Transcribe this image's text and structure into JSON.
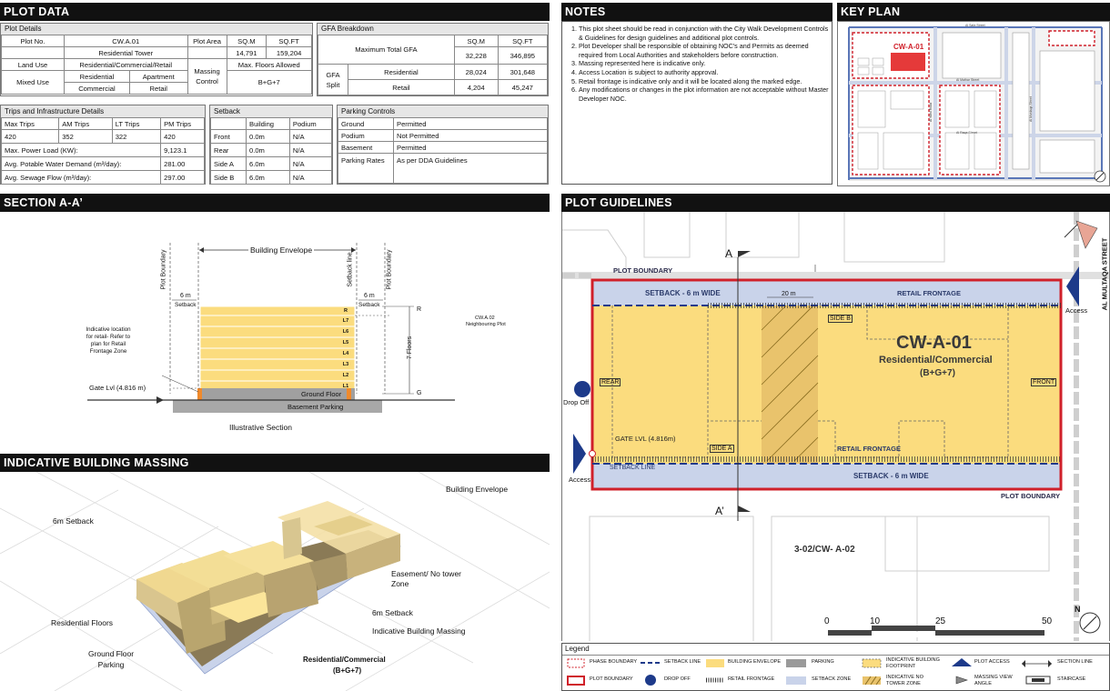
{
  "plot_data": {
    "header": "PLOT DATA",
    "plot_details": {
      "title": "Plot Details",
      "plot_no_label": "Plot No.",
      "plot_no": "CW.A.01",
      "residential_tower": "Residential Tower",
      "plot_area_label": "Plot Area",
      "sqm_label": "SQ.M",
      "sqft_label": "SQ.FT",
      "plot_area_sqm": "14,791",
      "plot_area_sqft": "159,204",
      "land_use_label": "Land Use",
      "land_use": "Residential/Commercial/Retail",
      "max_floors_label": "Max. Floors Allowed",
      "mixed_use_label": "Mixed Use",
      "residential": "Residential",
      "apartment": "Apartment",
      "commercial": "Commercial",
      "retail": "Retail",
      "massing_control_label": "Massing Control",
      "max_floors": "B+G+7"
    },
    "gfa": {
      "title": "GFA Breakdown",
      "max_total_label": "Maximum Total GFA",
      "sqm_label": "SQ.M",
      "sqft_label": "SQ.FT",
      "total_sqm": "32,228",
      "total_sqft": "346,895",
      "split_label": "GFA Split",
      "residential_label": "Residential",
      "residential_sqm": "28,024",
      "residential_sqft": "301,648",
      "retail_label": "Retail",
      "retail_sqm": "4,204",
      "retail_sqft": "45,247"
    },
    "trips": {
      "title": "Trips and Infrastructure Details",
      "headers": [
        "Max Trips",
        "AM Trips",
        "LT Trips",
        "PM Trips"
      ],
      "values": [
        "420",
        "352",
        "322",
        "420"
      ],
      "power_label": "Max. Power Load (KW):",
      "power": "9,123.1",
      "water_label": "Avg. Potable Water Demand (m³/day):",
      "water": "281.00",
      "sewage_label": "Avg. Sewage Flow (m³/day):",
      "sewage": "297.00"
    },
    "setback": {
      "title": "Setback",
      "col_building": "Building",
      "col_podium": "Podium",
      "rows": [
        {
          "side": "Front",
          "building": "0.0m",
          "podium": "N/A"
        },
        {
          "side": "Rear",
          "building": "0.0m",
          "podium": "N/A"
        },
        {
          "side": "Side A",
          "building": "6.0m",
          "podium": "N/A"
        },
        {
          "side": "Side B",
          "building": "6.0m",
          "podium": "N/A"
        }
      ]
    },
    "parking": {
      "title": "Parking Controls",
      "rows": [
        {
          "label": "Ground",
          "value": "Permitted"
        },
        {
          "label": "Podium",
          "value": "Not Permitted"
        },
        {
          "label": "Basement",
          "value": "Permitted"
        },
        {
          "label": "Parking Rates",
          "value": "As per DDA Guidelines"
        }
      ]
    }
  },
  "notes": {
    "header": "NOTES",
    "items": [
      "This plot sheet should be read in conjunction with the City Walk Development Controls & Guidelines for design guidelines and additional plot controls.",
      "Plot Developer shall be responsible of obtaining NOC's and Permits as deemed required from Local Authorities and stakeholders before construction.",
      "Massing represented here is indicative only.",
      "Access Location is subject to authority approval.",
      "Retail frontage is indicative only and it will be located along the marked edge.",
      "Any modifications or changes in the plot information are not acceptable without Master Developer NOC."
    ]
  },
  "key_plan": {
    "header": "KEY PLAN",
    "plot_label": "CW-A-01",
    "streets": [
      "Al Safa Street",
      "Al Wasl Road",
      "Al Mustaqa Street",
      "Al Mathar Street",
      "Al Raqa Street"
    ]
  },
  "section": {
    "header": "SECTION A-A’",
    "building_envelope": "Building Envelope",
    "plot_boundary": "Plot Boundary",
    "setback_line": "Setback line",
    "dim_left": "6 m",
    "dim_right": "6 m",
    "setback": "Setback",
    "floors": [
      "R",
      "L7",
      "L6",
      "L5",
      "L4",
      "L3",
      "L2",
      "L1"
    ],
    "g_label": "G",
    "floors_label": "7 Floors",
    "neighbour_code": "CW.A.02",
    "neighbour_text": "Neighbouring Plot",
    "indicative_note": "Indicative location for retail- Refer to plan for Retail Frontage Zone",
    "gate_level": "Gate Lvl (4.816 m)",
    "ground_floor": "Ground Floor",
    "basement": "Basement Parking",
    "caption": "Illustrative Section"
  },
  "massing": {
    "header": "INDICATIVE BUILDING MASSING",
    "labels": {
      "envelope": "Building Envelope",
      "setback": "6m Setback",
      "easement": "Easement/ No tower Zone",
      "setback2": "6m Setback",
      "residential_floors": "Residential Floors",
      "indicative": "Indicative Building Massing",
      "ground_parking": "Ground Floor Parking",
      "use": "Residential/Commercial",
      "floors": "(B+G+7)"
    }
  },
  "guidelines": {
    "header": "PLOT GUIDELINES",
    "plot_code": "CW-A-01",
    "use": "Residential/Commercial",
    "floors": "(B+G+7)",
    "plot_boundary": "PLOT BOUNDARY",
    "setback_top": "SETBACK - 6 m WIDE",
    "setback_bottom": "SETBACK - 6 m WIDE",
    "retail_top": "RETAIL FRONTAGE",
    "retail_bottom": "RETAIL FRONTAGE",
    "side_b": "SIDE B",
    "side_a": "SIDE A",
    "rear": "REAR",
    "front": "FRONT",
    "gate": "GATE LVL (4.816m)",
    "setback_line": "SETBACK LINE",
    "dim_20": "20 m",
    "section_a": "A",
    "section_a2": "A’",
    "access_right": "Access",
    "access_left": "Access",
    "drop_off": "Drop Off",
    "street": "AL MULTAQA STREET",
    "neighbour": "3-02/CW- A-02",
    "scale": [
      "0",
      "10",
      "25",
      "50"
    ],
    "north": "N"
  },
  "legend": {
    "title": "Legend",
    "items": [
      {
        "text": "PHASE BOUNDARY"
      },
      {
        "text": "SETBACK LINE"
      },
      {
        "text": "BUILDING ENVELOPE"
      },
      {
        "text": "PARKING"
      },
      {
        "text": "INDICATIVE BUILDING FOOTPRINT"
      },
      {
        "text": "PLOT ACCESS"
      },
      {
        "text": "SECTION LINE"
      },
      {
        "text": "PLOT BOUNDARY"
      },
      {
        "text": "DROP OFF"
      },
      {
        "text": "RETAIL FRONTAGE"
      },
      {
        "text": "SETBACK ZONE"
      },
      {
        "text": "INDICATIVE NO TOWER ZONE"
      },
      {
        "text": "MASSING VIEW ANGLE"
      },
      {
        "text": "STAIRCASE"
      }
    ]
  },
  "colors": {
    "header_bg": "#111111",
    "plot_red": "#d0202a",
    "envelope_yellow": "#fbdc7e",
    "setback_blue": "#c9d3ea",
    "access_blue": "#1d3a8a",
    "parking_gray": "#9a9a9a"
  }
}
